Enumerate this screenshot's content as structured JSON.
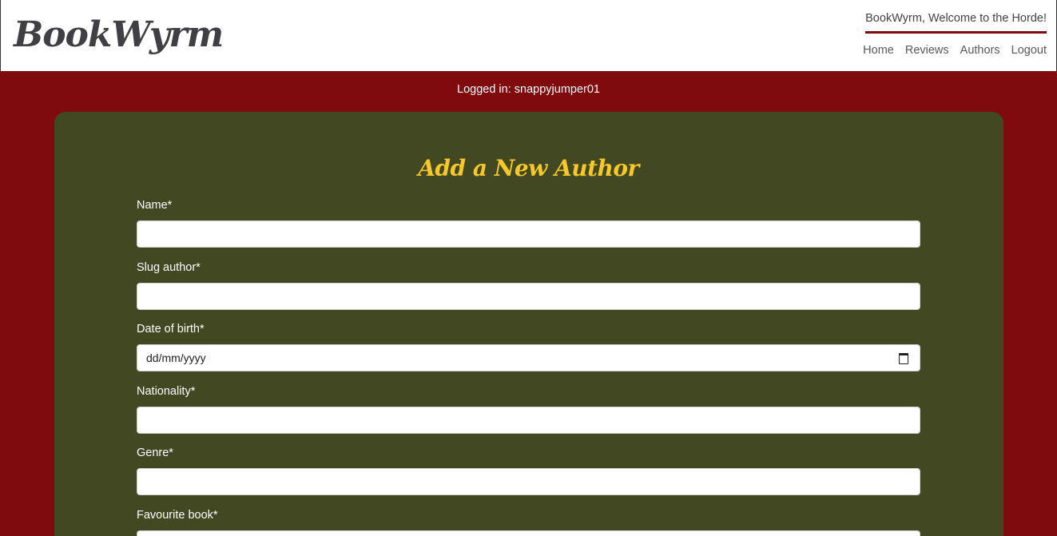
{
  "header": {
    "brand": "BookWyrm",
    "welcome": "BookWyrm, Welcome to the Horde!",
    "nav": [
      "Home",
      "Reviews",
      "Authors",
      "Logout"
    ]
  },
  "status": "Logged in: snappyjumper01",
  "form": {
    "title": "Add a New Author",
    "fields": [
      {
        "label": "Name*",
        "value": ""
      },
      {
        "label": "Slug author*",
        "value": ""
      },
      {
        "label": "Date of birth*",
        "value": "dd/mm/yyyy"
      },
      {
        "label": "Nationality*",
        "value": ""
      },
      {
        "label": "Genre*",
        "value": ""
      },
      {
        "label": "Favourite book*",
        "value": ""
      }
    ]
  },
  "colors": {
    "brand_dark": "#3f3f44",
    "accent_red": "#7f0b0e",
    "card_green": "#424822",
    "title_yellow": "#f7c928"
  },
  "icons": {
    "date_picker": "calendar-icon"
  }
}
